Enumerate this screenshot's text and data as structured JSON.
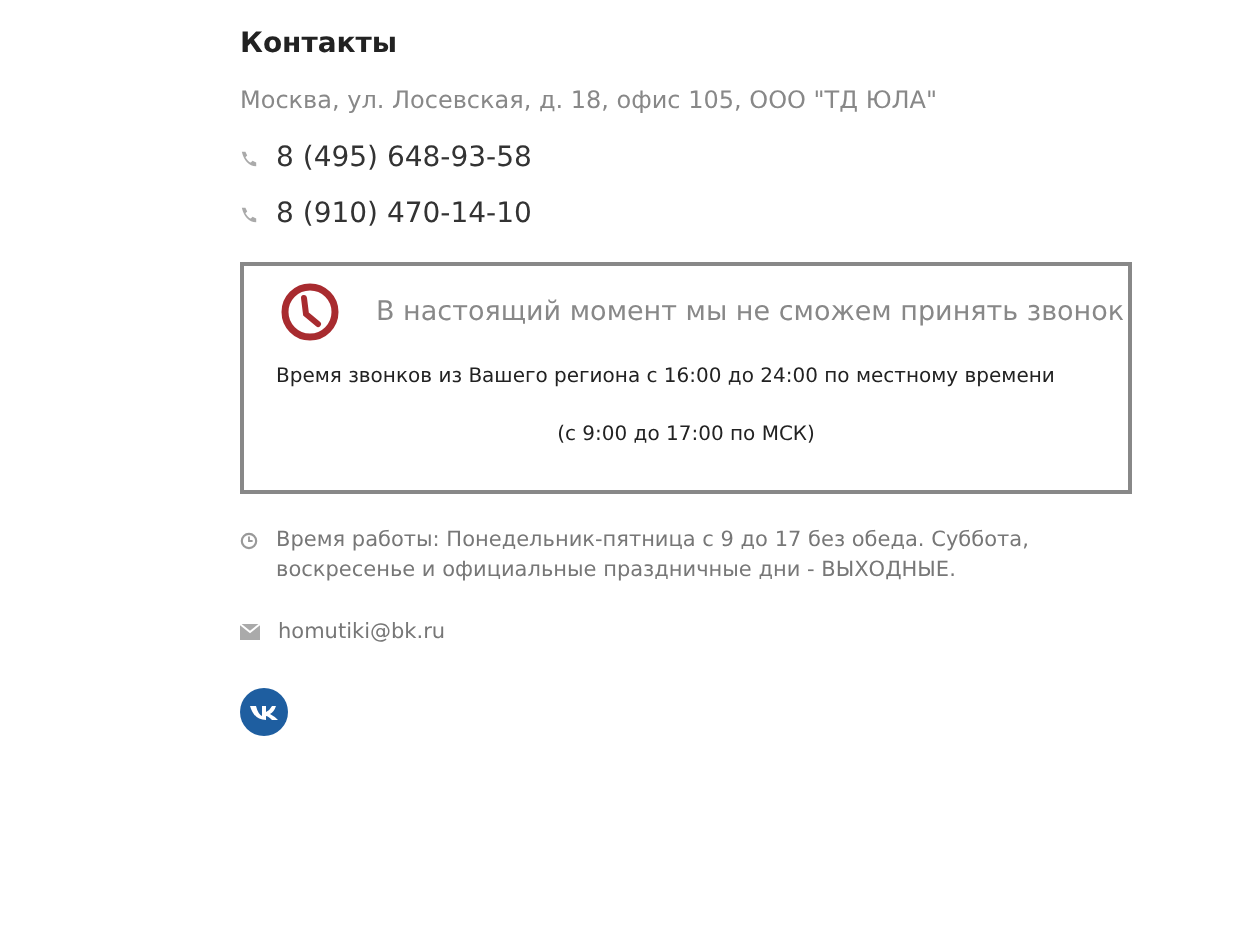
{
  "heading": "Контакты",
  "address": "Москва, ул. Лосевская, д. 18, офис 105, ООО \"ТД ЮЛА\"",
  "phones": [
    "8 (495) 648-93-58",
    "8 (910) 470-14-10"
  ],
  "notice": {
    "title": "В настоящий момент мы не сможем принять звонок",
    "line_1": "Время звонков из Вашего региона с 16:00 до 24:00 по местному времени",
    "line_2": "(с 9:00 до 17:00 по МСК)"
  },
  "hours": "Время работы: Понедельник-пятница с 9 до 17 без обеда. Суббота, воскресенье и официальные праздничные дни - ВЫХОДНЫЕ.",
  "email": "homutiki@bk.ru"
}
